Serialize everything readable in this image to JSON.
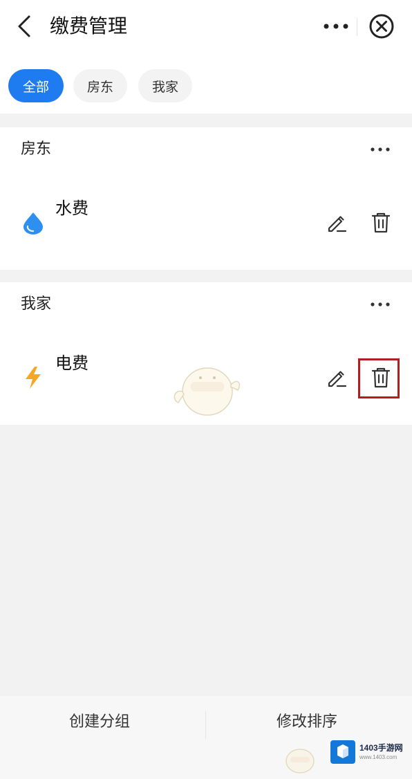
{
  "header": {
    "title": "缴费管理",
    "back_icon": "chevron-left-icon",
    "more_icon": "ellipsis-icon",
    "close_icon": "circle-close-icon"
  },
  "filters": {
    "active": "全部",
    "items": [
      {
        "label": "全部"
      },
      {
        "label": "房东"
      },
      {
        "label": "我家"
      }
    ]
  },
  "groups": [
    {
      "title": "房东",
      "items": [
        {
          "name": "水费",
          "icon": "water-drop-icon",
          "icon_color": "#2f8ff0"
        }
      ]
    },
    {
      "title": "我家",
      "items": [
        {
          "name": "电费",
          "icon": "lightning-icon",
          "icon_color": "#f5a623"
        }
      ]
    }
  ],
  "bottom": {
    "create_group": "创建分组",
    "modify_sort": "修改排序"
  },
  "watermark": {
    "brand": "1403手游网",
    "sub": "www.1403.com"
  },
  "colors": {
    "accent": "#1f7bf0",
    "highlight_border": "#b21e1e"
  }
}
